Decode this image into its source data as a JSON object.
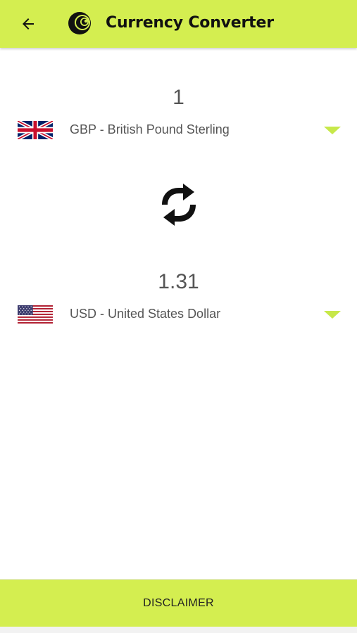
{
  "header": {
    "title": "Currency Converter",
    "back_icon": "arrow-left-icon",
    "logo_icon": "app-logo-icon",
    "background_color": "#d4ee50"
  },
  "from": {
    "amount": "1",
    "currency": "GBP - British Pound Sterling",
    "flag_icon": "uk-flag-icon"
  },
  "swap": {
    "icon": "swap-refresh-icon"
  },
  "to": {
    "amount": "1.31",
    "currency": "USD - United States Dollar",
    "flag_icon": "us-flag-icon"
  },
  "footer": {
    "disclaimer_label": "DISCLAIMER"
  },
  "colors": {
    "accent": "#d4ee50",
    "dropdown_arrow": "#c7e84a"
  }
}
